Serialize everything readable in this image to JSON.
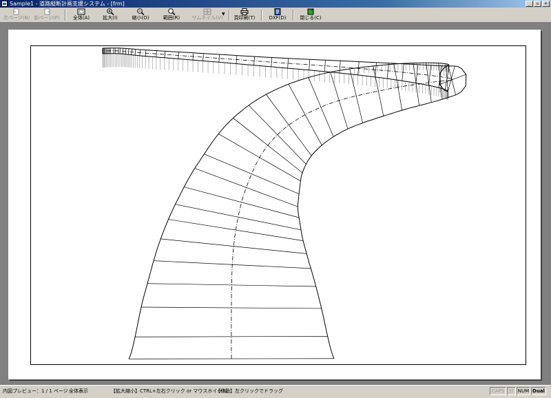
{
  "window": {
    "title": "Sample1 - 道路縦断計画支援システム - [frm]",
    "buttons": [
      "_",
      "▫",
      "×"
    ]
  },
  "toolbar": {
    "prev_page": "次ページ(N)",
    "next_page": "前ページ(P)",
    "fit_all": "全体(A)",
    "zoom_in": "拡大(I)",
    "zoom_out": "縮小(O)",
    "range": "範囲(R)",
    "thumbnail": "サムネイル(V)",
    "page_print": "頁印刷(T)",
    "dxf": "DXF(D)",
    "close": "閉じる(C)"
  },
  "status": {
    "preview": "内図プレビュー：1 / 1 ページ",
    "mode": "全体表示",
    "zoom_hint": "【拡大縮小】CTRL+左右クリック or マウスホイール",
    "move_hint": "【移動】左クリックでドラッグ",
    "indicators": [
      "CAPS",
      "ｶﾅ",
      "NUM",
      "Dual"
    ]
  }
}
